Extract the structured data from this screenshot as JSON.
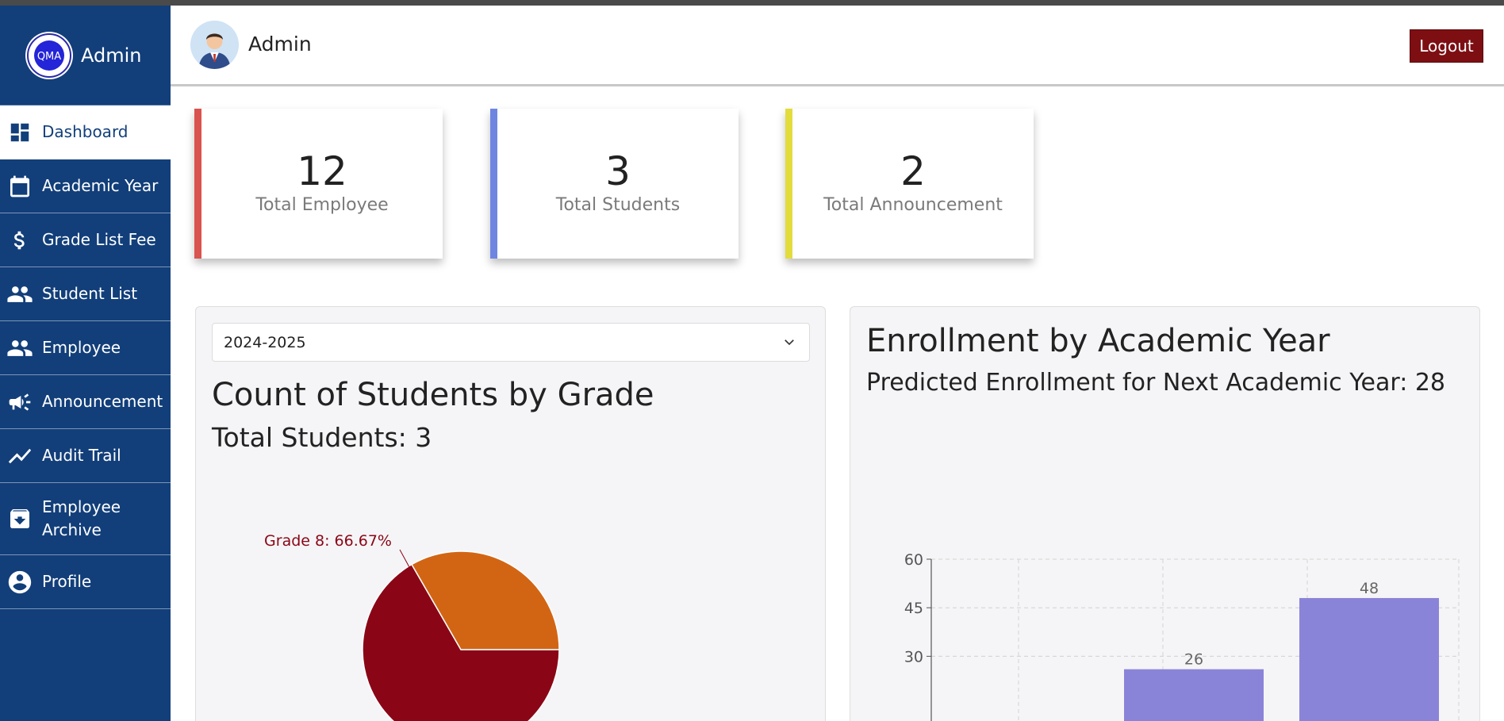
{
  "brand": {
    "title": "Admin",
    "logo_text": "QMA"
  },
  "sidebar": {
    "items": [
      {
        "label": "Dashboard",
        "icon": "dashboard-icon",
        "active": true
      },
      {
        "label": "Academic Year",
        "icon": "calendar-icon"
      },
      {
        "label": "Grade List Fee",
        "icon": "dollar-icon"
      },
      {
        "label": "Student List",
        "icon": "people-icon"
      },
      {
        "label": "Employee",
        "icon": "people-icon"
      },
      {
        "label": "Announcement",
        "icon": "megaphone-icon"
      },
      {
        "label": "Audit Trail",
        "icon": "trend-line-icon"
      },
      {
        "label": "Employee Archive",
        "icon": "archive-icon"
      },
      {
        "label": "Profile",
        "icon": "account-circle-icon"
      }
    ]
  },
  "header": {
    "user_name": "Admin",
    "logout_label": "Logout"
  },
  "stats": [
    {
      "value": "12",
      "label": "Total Employee",
      "color": "#d9534f"
    },
    {
      "value": "3",
      "label": "Total Students",
      "color": "#6f86e0"
    },
    {
      "value": "2",
      "label": "Total Announcement",
      "color": "#e3dc3d"
    }
  ],
  "grade_panel": {
    "selected_year": "2024-2025",
    "title": "Count of Students by Grade",
    "subtitle": "Total Students: 3"
  },
  "enrollment_panel": {
    "title": "Enrollment by Academic Year",
    "subtitle": "Predicted Enrollment for Next Academic Year: 28"
  },
  "chart_data": [
    {
      "type": "pie",
      "title": "Count of Students by Grade",
      "labels": [
        "Grade 8"
      ],
      "values": [
        66.67
      ],
      "data_labels": [
        "Grade 8: 66.67%"
      ],
      "colors": [
        "#8a0616",
        "#d26514"
      ],
      "note": "second slice (33.33%) label not visible"
    },
    {
      "type": "bar",
      "title": "Enrollment by Academic Year",
      "values": [
        26,
        48
      ],
      "data_labels": [
        "26",
        "48"
      ],
      "ylim": [
        0,
        60
      ],
      "yticks": [
        30,
        45,
        60
      ],
      "grid": true,
      "color": "#8a84d8"
    }
  ]
}
